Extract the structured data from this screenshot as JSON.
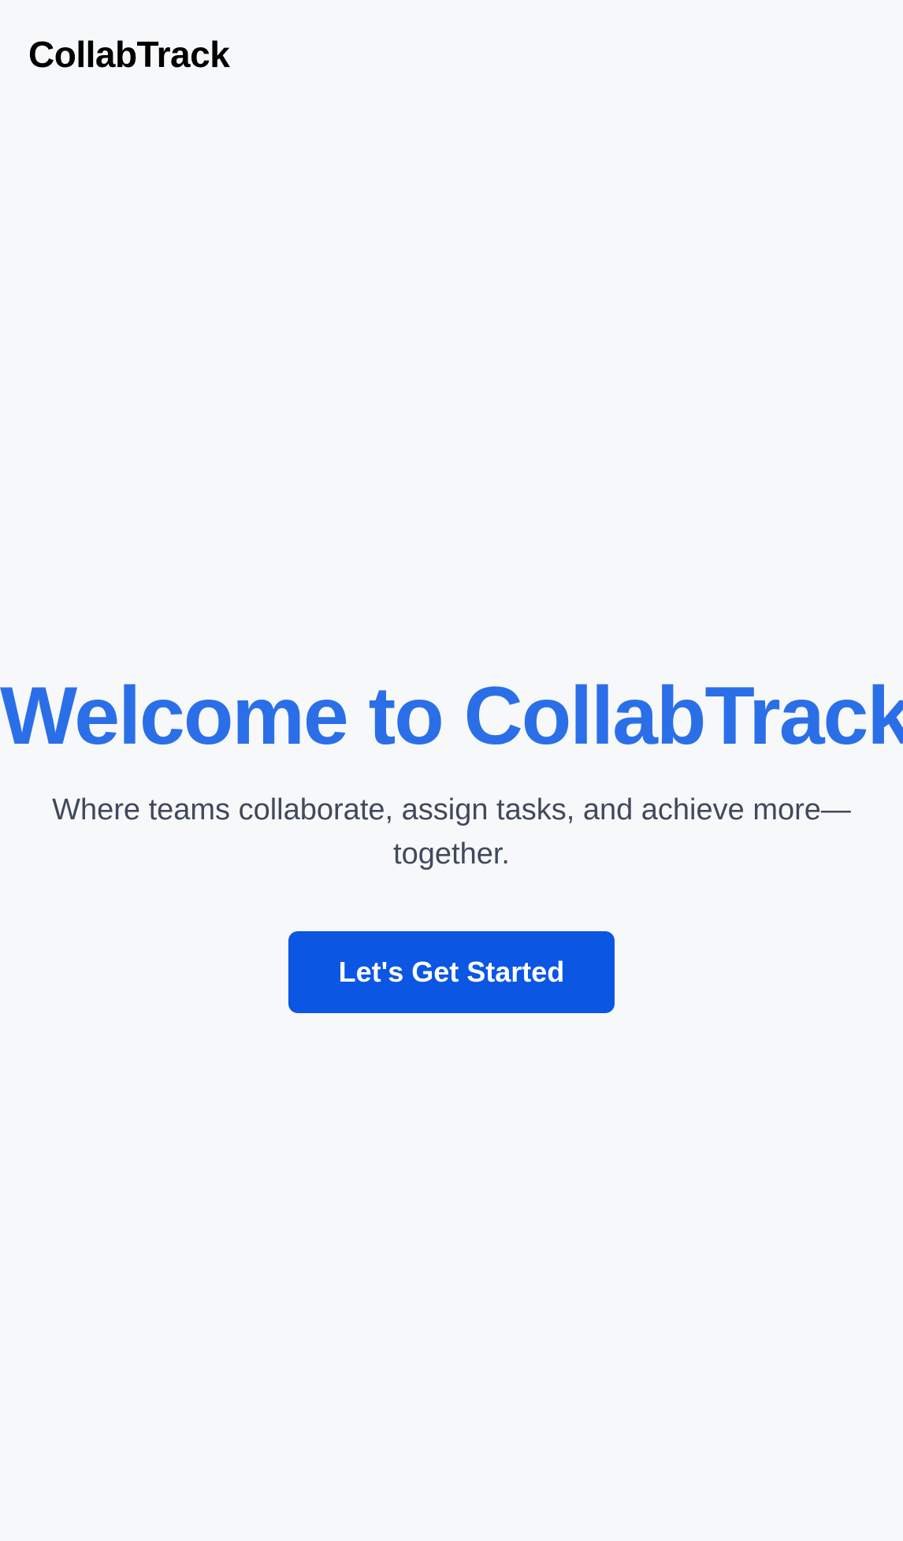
{
  "header": {
    "logo_text": "CollabTrack"
  },
  "hero": {
    "title": "Welcome to CollabTrack",
    "subtitle": "Where teams collaborate, assign tasks, and achieve more—together.",
    "cta_label": "Let's Get Started"
  },
  "colors": {
    "background": "#f7f8fa",
    "title": "#2b6fe8",
    "subtitle": "#414a5c",
    "button": "#0c56e4",
    "button_text": "#ffffff"
  }
}
